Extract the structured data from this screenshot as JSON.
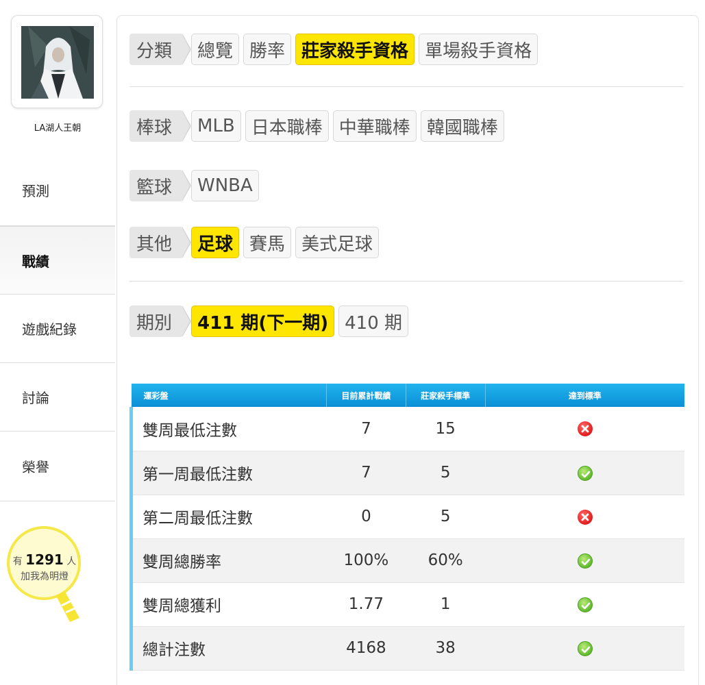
{
  "user": {
    "name": "LA湖人王朝"
  },
  "nav": {
    "predict": "預測",
    "record": "戰績",
    "game_log": "遊戲紀錄",
    "discuss": "討論",
    "honor": "榮譽"
  },
  "bulb": {
    "prefix": "有",
    "count": "1291",
    "suffix": "人",
    "subtitle": "加我為明燈"
  },
  "category": {
    "label": "分類",
    "items": [
      "總覽",
      "勝率",
      "莊家殺手資格",
      "單場殺手資格"
    ],
    "selected": "莊家殺手資格"
  },
  "baseball": {
    "label": "棒球",
    "items": [
      "MLB",
      "日本職棒",
      "中華職棒",
      "韓國職棒"
    ]
  },
  "basketball": {
    "label": "籃球",
    "items": [
      "WNBA"
    ]
  },
  "other": {
    "label": "其他",
    "items": [
      "足球",
      "賽馬",
      "美式足球"
    ],
    "selected": "足球"
  },
  "period": {
    "label": "期別",
    "items": [
      "411 期(下一期)",
      "410 期"
    ],
    "selected": "411 期(下一期)"
  },
  "table": {
    "headers": [
      "運彩盤",
      "目前累計戰績",
      "莊家殺手標準",
      "達到標準"
    ],
    "rows": [
      {
        "name": "雙周最低注數",
        "current": "7",
        "standard": "15",
        "met": "fail"
      },
      {
        "name": "第一周最低注數",
        "current": "7",
        "standard": "5",
        "met": "pass"
      },
      {
        "name": "第二周最低注數",
        "current": "0",
        "standard": "5",
        "met": "fail"
      },
      {
        "name": "雙周總勝率",
        "current": "100%",
        "standard": "60%",
        "met": "pass"
      },
      {
        "name": "雙周總獲利",
        "current": "1.77",
        "standard": "1",
        "met": "pass"
      },
      {
        "name": "總計注數",
        "current": "4168",
        "standard": "38",
        "met": "pass"
      }
    ]
  },
  "colors": {
    "accent": "#ffe600",
    "header_blue": "#0a8fd6",
    "pass": "#5cb82a",
    "fail": "#e21b1b"
  }
}
